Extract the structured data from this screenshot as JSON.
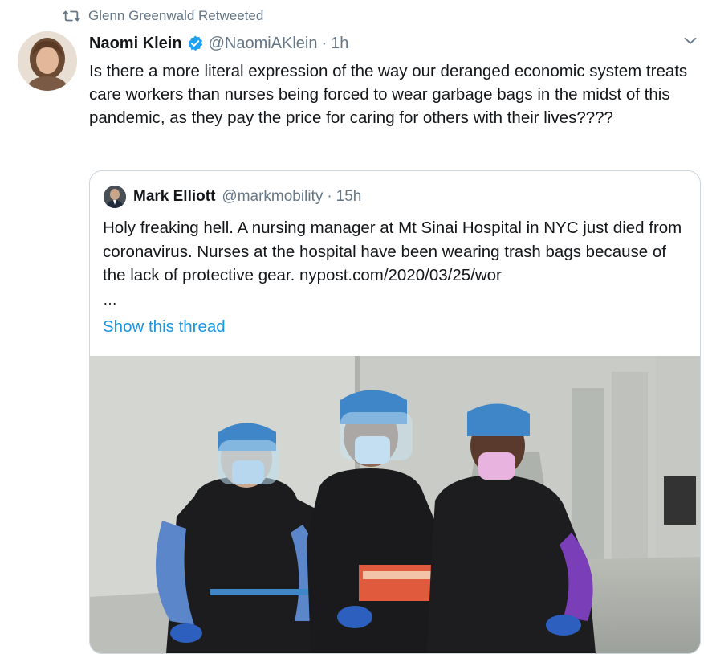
{
  "retweet": {
    "label": "Glenn Greenwald Retweeted",
    "icon": "retweet-icon"
  },
  "tweet": {
    "name": "Naomi Klein",
    "handle": "@NaomiAKlein",
    "separator": "·",
    "time": "1h",
    "text": "Is there a more literal expression of the way our deranged economic system treats care workers than nurses being forced to wear garbage bags in the midst of this pandemic, as they pay the price for caring for others with their lives????"
  },
  "quoted": {
    "name": "Mark Elliott",
    "handle": "@markmobility",
    "separator": "·",
    "time": "15h",
    "text": "Holy freaking hell. A nursing manager at Mt Sinai Hospital in NYC just died from coronavirus. Nurses at the hospital have been wearing trash bags because of the lack of protective gear. nypost.com/2020/03/25/wor",
    "ellipsis": "…",
    "show_thread": "Show this thread"
  },
  "colors": {
    "text": "#14171a",
    "secondary": "#657786",
    "link": "#1b95e0",
    "verified": "#1da1f2",
    "border": "#ccd6dd"
  }
}
